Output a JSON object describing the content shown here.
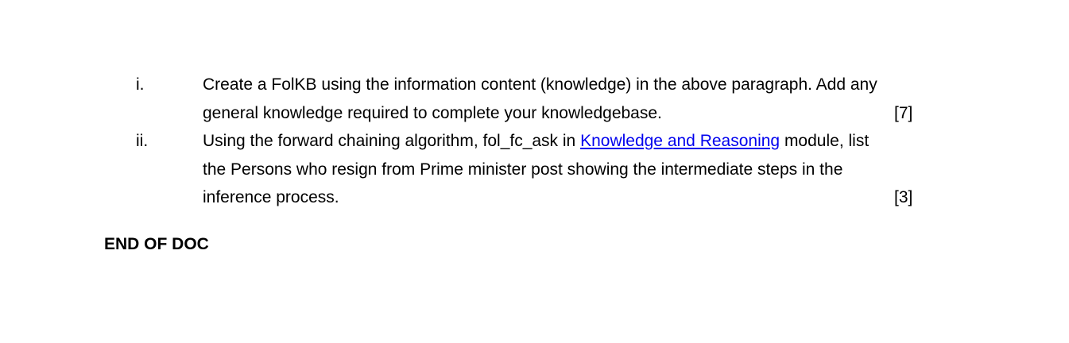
{
  "questions": [
    {
      "numeral": "i.",
      "line1": "Create a FolKB using the information content (knowledge) in the above paragraph. Add any",
      "line2": "general knowledge required to complete your knowledgebase.",
      "marks": "[7]"
    },
    {
      "numeral": "ii.",
      "line1_before": "Using the forward chaining algorithm, fol_fc_ask in ",
      "link_text": "Knowledge and Reasoning",
      "line1_after": " module, list",
      "line2": "the Persons who resign from Prime minister post showing the intermediate steps in the",
      "line3": "inference process.",
      "marks": "[3]"
    }
  ],
  "footer": {
    "text": "END OF DOC"
  }
}
